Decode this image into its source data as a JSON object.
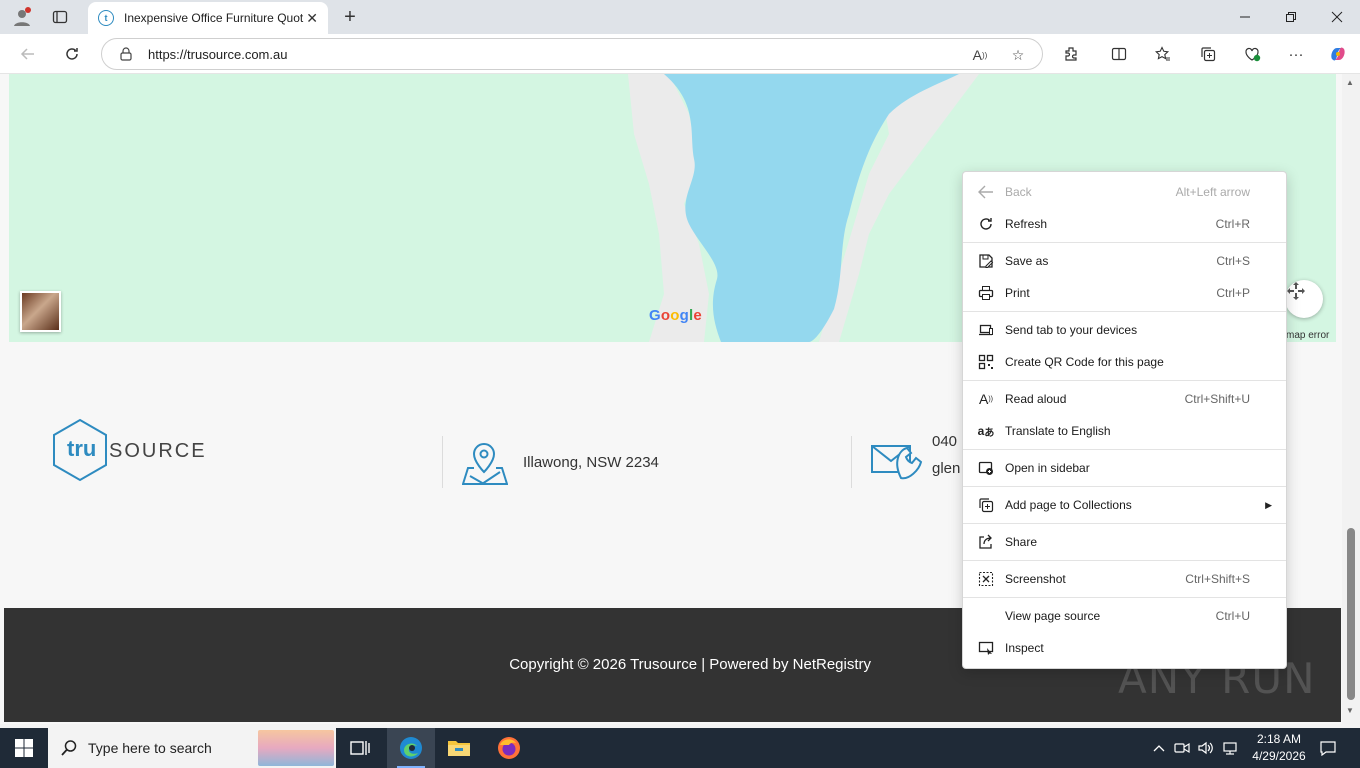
{
  "browser": {
    "tab_title": "Inexpensive Office Furniture Quot",
    "url": "https://trusource.com.au",
    "window_controls": {
      "minimize": "minimize-icon",
      "restore": "restore-icon",
      "close": "close-icon"
    }
  },
  "map": {
    "google_label": "Google",
    "error_label": "map error"
  },
  "footer_info": {
    "logo_tru": "tru",
    "logo_source": "SOURCE",
    "location": "Illawong, NSW 2234",
    "contact_line1": "040",
    "contact_line2": "glen"
  },
  "footer": {
    "copyright": "Copyright © 2026 Trusource | Powered by NetRegistry"
  },
  "context_menu": {
    "items": [
      {
        "label": "Back",
        "shortcut": "Alt+Left arrow",
        "icon": "back-arrow-icon",
        "disabled": true
      },
      {
        "label": "Refresh",
        "shortcut": "Ctrl+R",
        "icon": "refresh-icon"
      },
      {
        "label": "Save as",
        "shortcut": "Ctrl+S",
        "icon": "save-as-icon"
      },
      {
        "label": "Print",
        "shortcut": "Ctrl+P",
        "icon": "print-icon"
      },
      {
        "label": "Send tab to your devices",
        "shortcut": "",
        "icon": "send-tab-icon"
      },
      {
        "label": "Create QR Code for this page",
        "shortcut": "",
        "icon": "qr-code-icon"
      },
      {
        "label": "Read aloud",
        "shortcut": "Ctrl+Shift+U",
        "icon": "read-aloud-icon"
      },
      {
        "label": "Translate to English",
        "shortcut": "",
        "icon": "translate-icon"
      },
      {
        "label": "Open in sidebar",
        "shortcut": "",
        "icon": "sidebar-icon"
      },
      {
        "label": "Add page to Collections",
        "shortcut": "",
        "icon": "collections-icon"
      },
      {
        "label": "Share",
        "shortcut": "",
        "icon": "share-icon"
      },
      {
        "label": "Screenshot",
        "shortcut": "Ctrl+Shift+S",
        "icon": "screenshot-icon"
      },
      {
        "label": "View page source",
        "shortcut": "Ctrl+U",
        "icon": ""
      },
      {
        "label": "Inspect",
        "shortcut": "",
        "icon": "inspect-icon"
      }
    ]
  },
  "watermark": "ANY RUN",
  "taskbar": {
    "search_placeholder": "Type here to search",
    "time": "2:18 AM",
    "date": "4/29/2026"
  }
}
